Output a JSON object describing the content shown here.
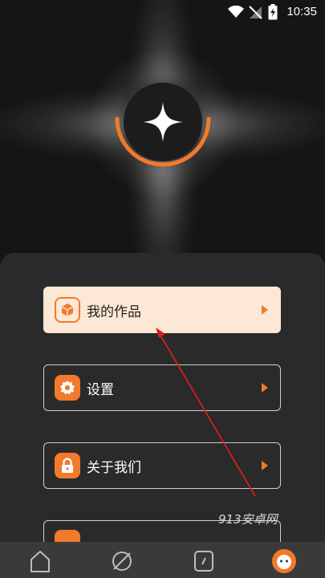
{
  "status": {
    "time": "10:35",
    "icons": [
      "wifi-icon",
      "no-signal-icon",
      "battery-charging-icon"
    ]
  },
  "hero": {
    "logo_icon": "sparkle-star-icon"
  },
  "menu": {
    "items": [
      {
        "label": "我的作品",
        "icon": "box-icon",
        "active": true
      },
      {
        "label": "设置",
        "icon": "gear-icon",
        "active": false
      },
      {
        "label": "关于我们",
        "icon": "lock-icon",
        "active": false
      }
    ]
  },
  "watermark": "913安卓网",
  "bottom_nav": {
    "items": [
      "home-icon",
      "planet-icon",
      "edit-icon",
      "profile-icon"
    ]
  },
  "colors": {
    "accent": "#f27a2c",
    "active_bg": "#fde8d5",
    "panel_bg": "#2a2a2a",
    "nav_bg": "#3a3a3a"
  }
}
